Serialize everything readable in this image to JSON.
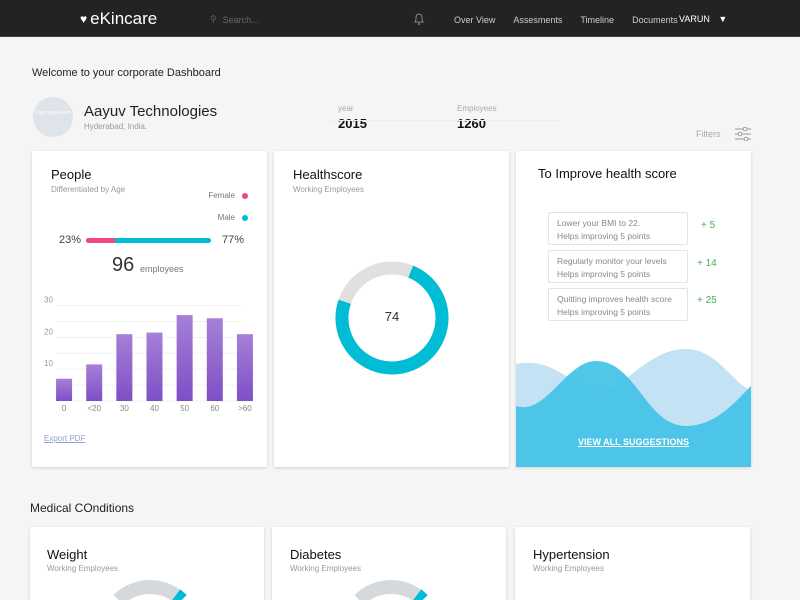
{
  "nav": {
    "brand": "eKincare",
    "search_placeholder": "Search...",
    "links": [
      "Over View",
      "Assesments",
      "Timeline",
      "Documents"
    ],
    "user": "VARUN"
  },
  "welcome": "Welcome to your corporate Dashboard",
  "company": {
    "logo_text": "Logo goes here",
    "name": "Aayuv Technologies",
    "location": "Hyderabad, India.",
    "year_label": "year",
    "year": "2015",
    "employees_label": "Employees",
    "employees": "1260"
  },
  "filters_label": "Filters",
  "people": {
    "title": "People",
    "subtitle": "Differentiated by Age",
    "female_label": "Female",
    "male_label": "Male",
    "female_pct": "23%",
    "male_pct": "77%",
    "female_fraction": 0.23,
    "count": "96",
    "count_label": "employees",
    "export": "Export PDF",
    "colors": {
      "female": "#f4467a",
      "male": "#00bcd4",
      "bar": "#8a5cc9"
    }
  },
  "chart_data": {
    "type": "bar",
    "categories": [
      "0",
      "<20",
      "30",
      "40",
      "50",
      "60",
      ">60"
    ],
    "values": [
      7,
      11.5,
      21,
      21.5,
      27,
      26,
      21
    ],
    "yticks": [
      "10",
      "20",
      "30"
    ],
    "ylim": [
      0,
      33
    ],
    "xlabel": "",
    "ylabel": "",
    "title": ""
  },
  "healthscore": {
    "title": "Healthscore",
    "subtitle": "Working Employees",
    "value": "74",
    "fraction": 0.74
  },
  "improve": {
    "title": "To Improve health score",
    "suggestions": [
      {
        "line1": "Lower your BMI to 22.",
        "line2": "Helps improving 5 points",
        "points": "+ 5"
      },
      {
        "line1": "Regularly monitor your levels",
        "line2": "Helps improving 5 points",
        "points": "+ 14"
      },
      {
        "line1": "Quitting improves health score",
        "line2": "Helps improving 5 points",
        "points": "+ 25"
      }
    ],
    "cta": "VIEW ALL SUGGESTIONS"
  },
  "medical": {
    "title": "Medical COnditions",
    "cards": [
      {
        "title": "Weight",
        "subtitle": "Working Employees"
      },
      {
        "title": "Diabetes",
        "subtitle": "Working Employees"
      },
      {
        "title": "Hypertension",
        "subtitle": "Working Employees"
      }
    ]
  }
}
